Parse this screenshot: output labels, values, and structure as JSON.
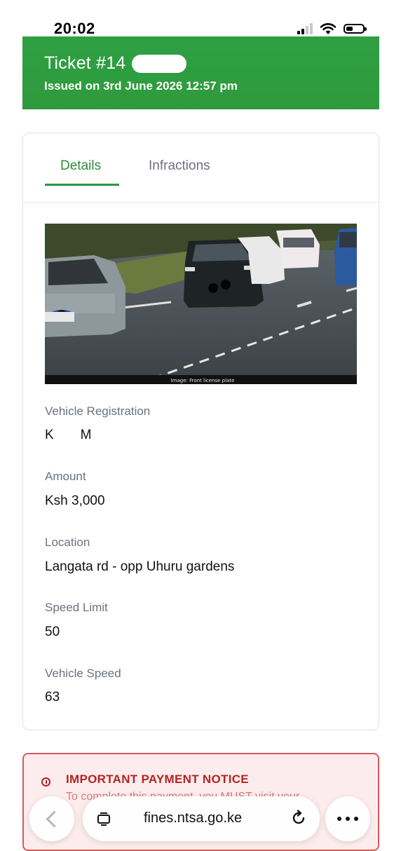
{
  "status_bar": {
    "time": "20:02",
    "icons": [
      "cellular-signal-icon",
      "wifi-icon",
      "battery-icon"
    ],
    "battery_level": 0.4
  },
  "header": {
    "title": "Ticket #14",
    "issued": "Issued on 3rd June 2026 12:57 pm",
    "background_color": "#2ea043"
  },
  "tabs": [
    {
      "label": "Details",
      "active": true
    },
    {
      "label": "Infractions",
      "active": false
    }
  ],
  "camera": {
    "caption": "Image: Front license plate"
  },
  "fields": {
    "vehicle_registration": {
      "label": "Vehicle Registration",
      "value": "K    M"
    },
    "amount": {
      "label": "Amount",
      "value": "Ksh 3,000"
    },
    "location": {
      "label": "Location",
      "value": "Langata rd - opp Uhuru gardens"
    },
    "speed_limit": {
      "label": "Speed Limit",
      "value": "50"
    },
    "vehicle_speed": {
      "label": "Vehicle Speed",
      "value": "63"
    }
  },
  "notice": {
    "icon": "info-icon",
    "title": "IMPORTANT PAYMENT NOTICE",
    "text": "To complete this payment, you MUST visit your"
  },
  "browser": {
    "url": "fines.ntsa.go.ke",
    "icons": [
      "back-chevron-icon",
      "tabs-icon",
      "reload-icon",
      "more-icon"
    ]
  },
  "colors": {
    "accent_green": "#2e8b3c",
    "notice_red": "#b42323"
  }
}
